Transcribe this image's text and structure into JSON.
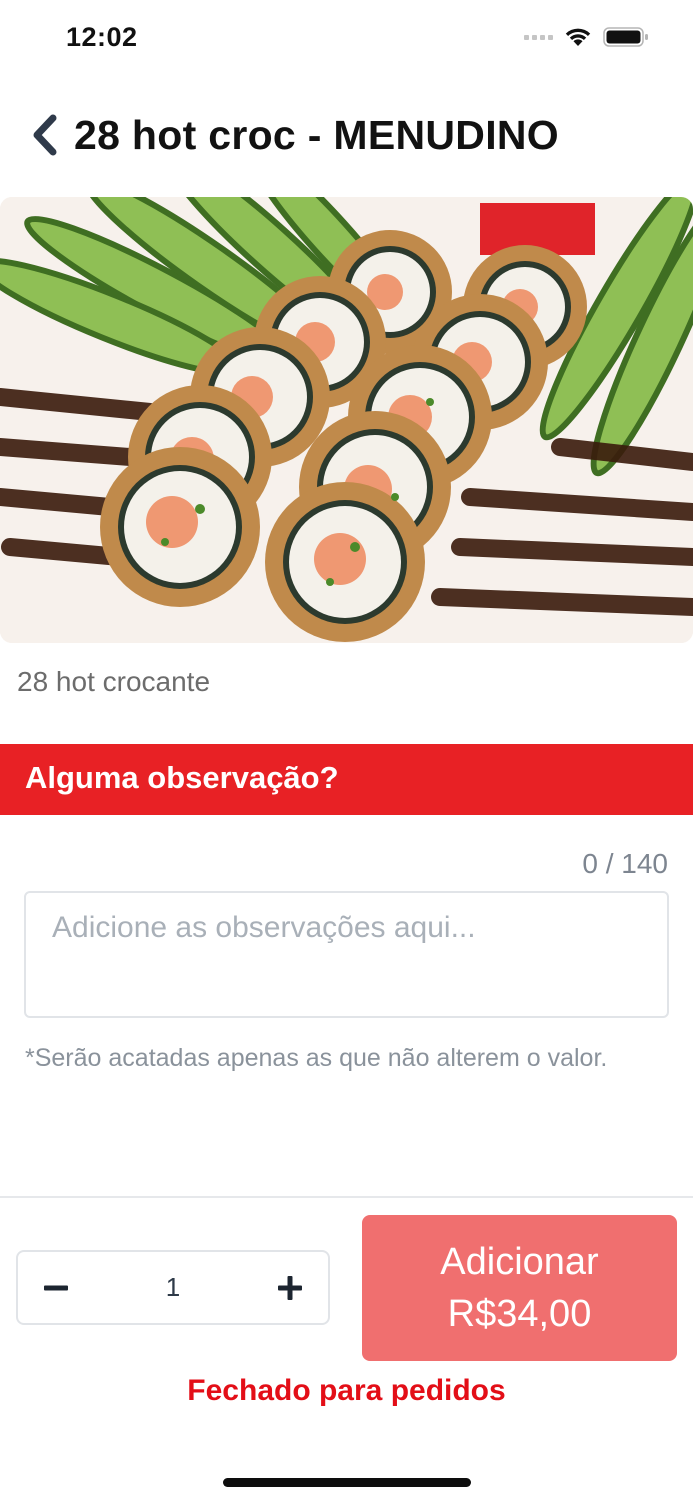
{
  "status_bar": {
    "time": "12:02",
    "signal_icon": "signal-dots-icon",
    "wifi_icon": "wifi-icon",
    "battery_icon": "battery-icon"
  },
  "header": {
    "back_icon": "chevron-left-icon",
    "title": "28 hot croc - MENUDINO"
  },
  "product": {
    "image_description": "sushi-photo",
    "description": "28 hot crocante"
  },
  "notes_section": {
    "title": "Alguma observação?",
    "counter": "0 / 140",
    "value": "",
    "placeholder": "Adicione as observações aqui...",
    "hint": "*Serão acatadas apenas as que não alterem o valor."
  },
  "order": {
    "quantity": "1",
    "minus_icon": "minus-icon",
    "plus_icon": "plus-icon",
    "add_label": "Adicionar",
    "add_price": "R$34,00",
    "closed_notice": "Fechado para pedidos"
  },
  "colors": {
    "accent": "#e82125",
    "button_disabled": "#f06f6f",
    "closed_text": "#e30e17",
    "muted_text": "#8a929b"
  }
}
